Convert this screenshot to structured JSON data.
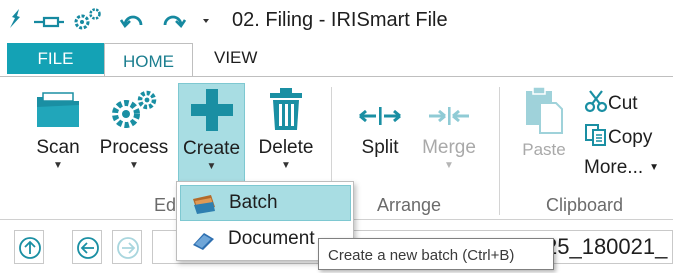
{
  "app": {
    "window_title": "02. Filing - IRISmart File",
    "accent_color": "#14a2b5"
  },
  "quick_access": {
    "icons": [
      "pin-icon",
      "connect-icon",
      "gears-icon",
      "undo-icon",
      "redo-icon",
      "customize-dropdown-icon"
    ]
  },
  "tabs": [
    {
      "label": "FILE"
    },
    {
      "label": "HOME",
      "selected": true
    },
    {
      "label": "VIEW"
    }
  ],
  "ribbon": {
    "scan": {
      "label": "Scan"
    },
    "process": {
      "label": "Process"
    },
    "create": {
      "label": "Create",
      "pressed": true
    },
    "delete": {
      "label": "Delete"
    },
    "split": {
      "label": "Split"
    },
    "merge": {
      "label": "Merge",
      "disabled": true
    },
    "paste": {
      "label": "Paste",
      "disabled": true
    },
    "cut": {
      "label": "Cut"
    },
    "copy": {
      "label": "Copy"
    },
    "more": {
      "label": "More..."
    },
    "groups": {
      "edit": "Ed",
      "arrange": "Arrange",
      "clipboard": "Clipboard"
    }
  },
  "create_menu": {
    "items": [
      {
        "label": "Batch",
        "icon": "batch-icon",
        "hover": true
      },
      {
        "label": "Document",
        "icon": "document-icon"
      }
    ]
  },
  "tooltip": {
    "text": "Create a new batch (Ctrl+B)"
  },
  "navigation": {
    "path_visible": "25_180021_"
  }
}
